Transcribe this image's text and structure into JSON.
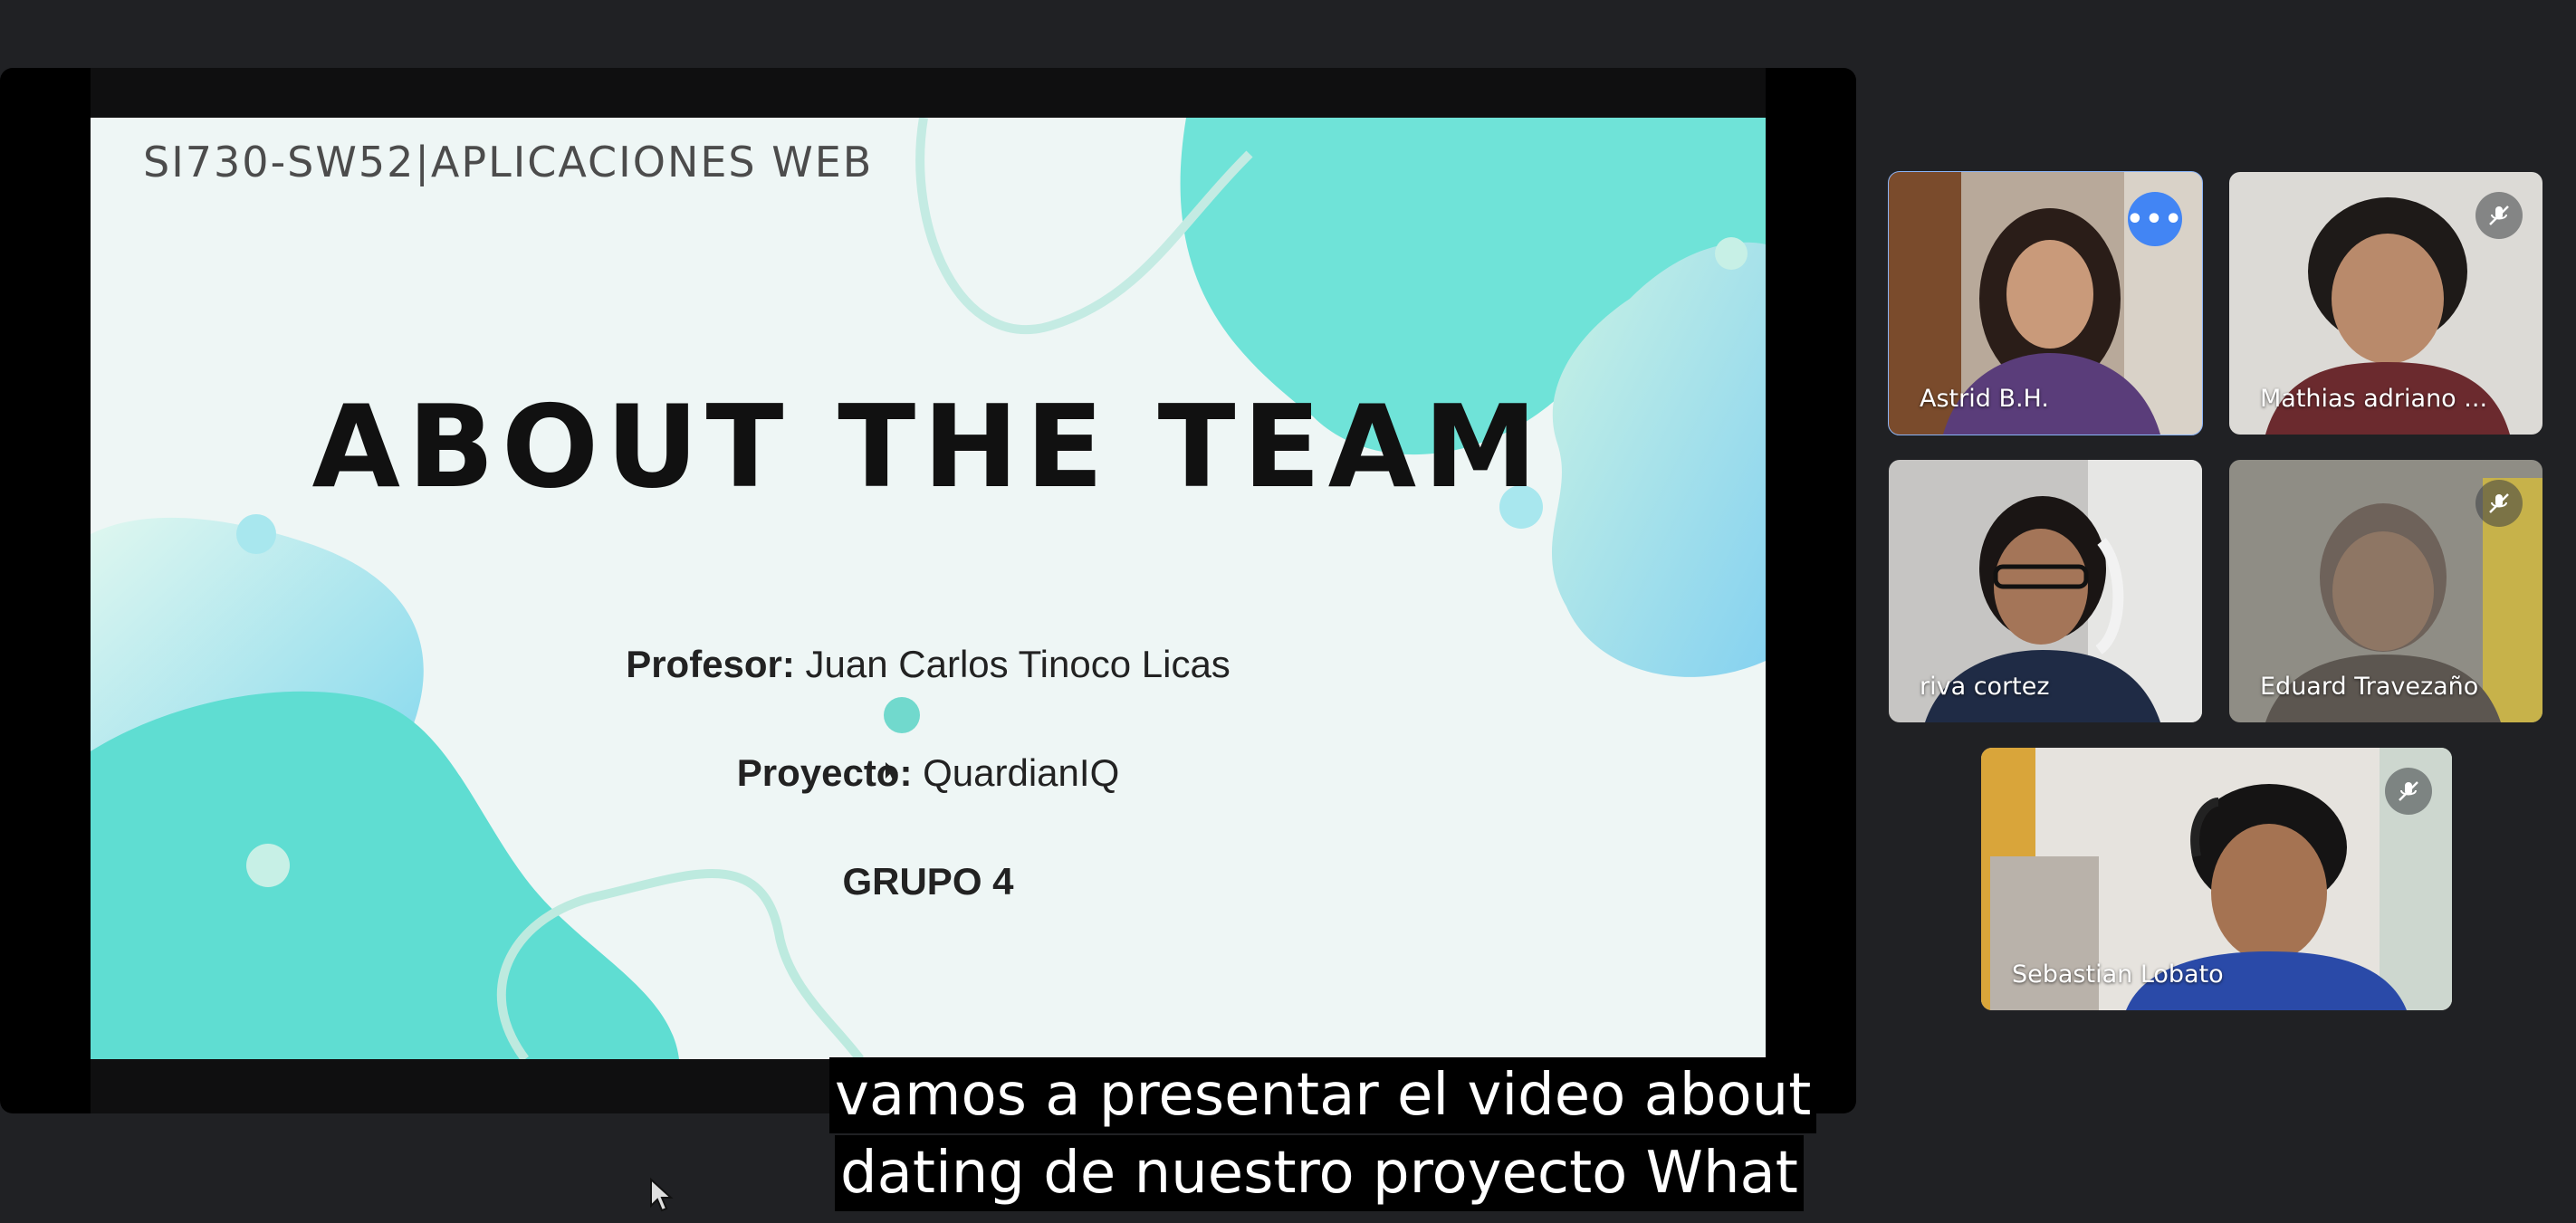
{
  "slide": {
    "course": "SI730-SW52|APLICACIONES WEB",
    "headline": "ABOUT THE TEAM",
    "profesor_label": "Profesor:",
    "profesor_value": " Juan Carlos Tinoco Licas",
    "proyecto_label": "Proyecto:",
    "proyecto_value": " QuardianIQ",
    "grupo": "GRUPO 4"
  },
  "participants": [
    {
      "name": "Astrid B.H.",
      "active": true,
      "muted": false
    },
    {
      "name": "Mathias adriano ...",
      "active": false,
      "muted": true
    },
    {
      "name": "riva cortez",
      "active": false,
      "muted": false
    },
    {
      "name": "Eduard Travezaño",
      "active": false,
      "muted": true
    },
    {
      "name": "Sebastian Lobato",
      "active": false,
      "muted": true
    }
  ],
  "captions": {
    "line1": "vamos a presentar el video about",
    "line2": "dating de nuestro proyecto What"
  },
  "colors": {
    "accent": "#8ab4f8",
    "more_button": "#4285f4",
    "teal": "#5ad3c6"
  }
}
